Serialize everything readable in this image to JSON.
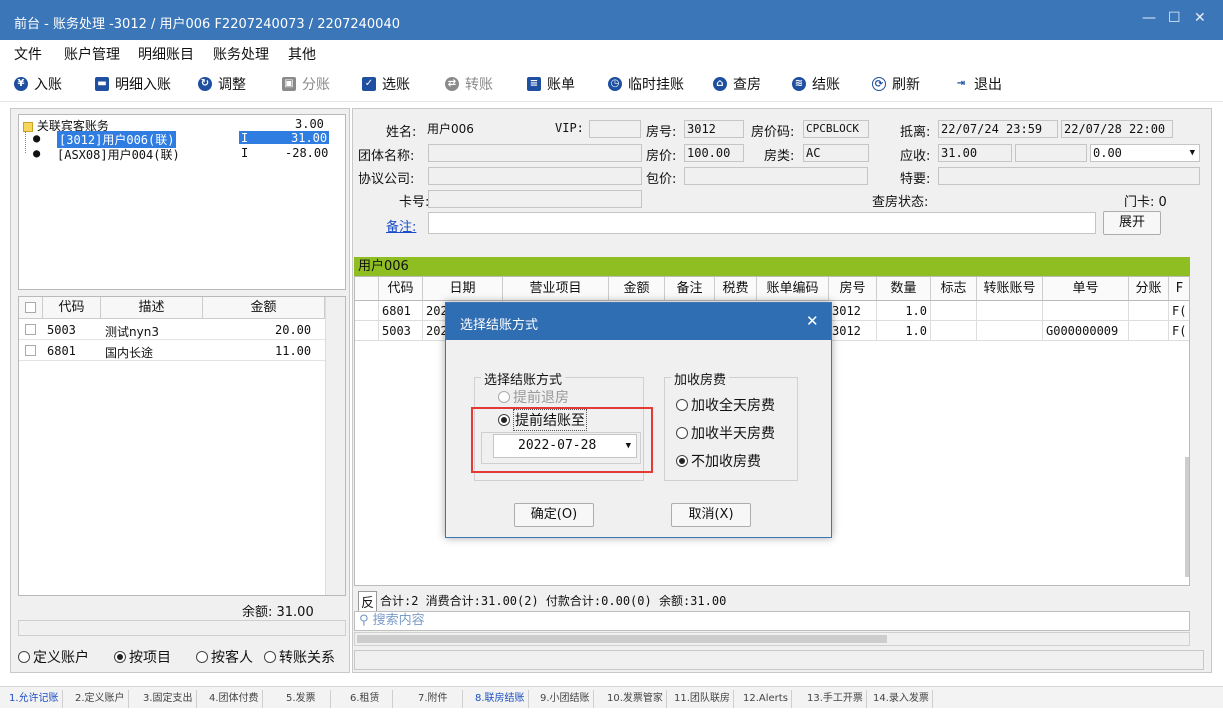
{
  "window": {
    "title": "前台 - 账务处理 -3012 / 用户006 F2207240073 / 2207240040",
    "controls": [
      "—",
      "☐",
      "✕"
    ]
  },
  "menu": [
    "文件",
    "账户管理",
    "明细账目",
    "账务处理",
    "其他"
  ],
  "toolbar": [
    {
      "label": "入账",
      "icon": "coin-icon",
      "color": "#1f4fa0",
      "enabled": true
    },
    {
      "label": "明细入账",
      "icon": "card-icon",
      "color": "#1f4fa0",
      "enabled": true
    },
    {
      "label": "调整",
      "icon": "adjust-icon",
      "color": "#1f4fa0",
      "enabled": true
    },
    {
      "label": "分账",
      "icon": "split-icon",
      "color": "#8a8a8a",
      "enabled": false
    },
    {
      "label": "选账",
      "icon": "select-icon",
      "color": "#1f4fa0",
      "enabled": true
    },
    {
      "label": "转账",
      "icon": "transfer-icon",
      "color": "#8a8a8a",
      "enabled": false
    },
    {
      "label": "账单",
      "icon": "bill-icon",
      "color": "#1f4fa0",
      "enabled": true
    },
    {
      "label": "临时挂账",
      "icon": "clock-icon",
      "color": "#1f4fa0",
      "enabled": true
    },
    {
      "label": "查房",
      "icon": "house-icon",
      "color": "#1f4fa0",
      "enabled": true
    },
    {
      "label": "结账",
      "icon": "stack-icon",
      "color": "#1f4fa0",
      "enabled": true
    },
    {
      "label": "刷新",
      "icon": "refresh-icon",
      "color": "#1f4fa0",
      "enabled": true
    },
    {
      "label": "退出",
      "icon": "exit-icon",
      "color": "#1f4fa0",
      "enabled": true
    }
  ],
  "tree": {
    "root": {
      "label": "关联宾客账务",
      "amount": "3.00"
    },
    "children": [
      {
        "label": "[3012]用户006(联)",
        "flag": "I",
        "amount": "31.00",
        "selected": true
      },
      {
        "label": "[ASX08]用户004(联)",
        "flag": "I",
        "amount": "-28.00",
        "selected": false
      }
    ]
  },
  "left_table": {
    "headers": [
      "代码",
      "描述",
      "金额"
    ],
    "rows": [
      {
        "code": "5003",
        "desc": "测试nyn3",
        "amount": "20.00"
      },
      {
        "code": "6801",
        "desc": "国内长途",
        "amount": "11.00"
      }
    ],
    "balance": "余额: 31.00"
  },
  "view_options": [
    {
      "label": "定义账户",
      "checked": false
    },
    {
      "label": "按项目",
      "checked": true
    },
    {
      "label": "按客人",
      "checked": false
    },
    {
      "label": "转账关系",
      "checked": false
    }
  ],
  "guest": {
    "name_label": "姓名:",
    "name": "用户006",
    "vip_label": "VIP:",
    "vip": "",
    "room_label": "房号:",
    "room": "3012",
    "rate_code_label": "房价码:",
    "rate_code": "CPCBLOCK",
    "arrival_label": "抵离:",
    "arrival": "22/07/24 23:59",
    "departure": "22/07/28 22:00",
    "group_label": "团体名称:",
    "group": "",
    "rate_label": "房价:",
    "rate": "100.00",
    "room_type_label": "房类:",
    "room_type": "AC",
    "receivable_label": "应收:",
    "receivable": "31.00",
    "receivable_extra": "0.00",
    "company_label": "协议公司:",
    "company": "",
    "package_label": "包价:",
    "package": "",
    "special_label": "特要:",
    "special": "",
    "card_label": "卡号:",
    "card": "",
    "checkroom_label": "查房状态:",
    "checkroom": "",
    "doorcard": "门卡: 0",
    "remark_label": "备注:",
    "remark": "",
    "expand_button": "展开"
  },
  "grid": {
    "owner": "用户006",
    "headers": [
      "代码",
      "日期",
      "营业项目",
      "金额",
      "备注",
      "税费",
      "账单编码",
      "房号",
      "数量",
      "标志",
      "转账账号",
      "单号",
      "分账",
      "F"
    ],
    "rows": [
      [
        "6801",
        "202",
        "",
        "",
        "",
        "",
        "",
        "3012",
        "1.0",
        "",
        "",
        "",
        "",
        "F("
      ],
      [
        "5003",
        "202",
        "",
        "",
        "",
        "",
        "",
        "3012",
        "1.0",
        "",
        "",
        "G000000009",
        "",
        "F("
      ]
    ]
  },
  "summary": {
    "flip": "反",
    "text": "合计:2  消费合计:31.00(2)  付款合计:0.00(0)  余额:31.00"
  },
  "search": {
    "placeholder": "搜索内容"
  },
  "tabs": [
    {
      "label": "1.允许记账",
      "active": true
    },
    {
      "label": "2.定义账户",
      "active": false
    },
    {
      "label": "3.固定支出",
      "active": false
    },
    {
      "label": "4.团体付费",
      "active": false
    },
    {
      "label": "5.发票",
      "active": false
    },
    {
      "label": "6.租赁",
      "active": false
    },
    {
      "label": "7.附件",
      "active": false
    },
    {
      "label": "8.联房结账",
      "active": true
    },
    {
      "label": "9.小团结账",
      "active": false
    },
    {
      "label": "10.发票管家",
      "active": false
    },
    {
      "label": "11.团队联房",
      "active": false
    },
    {
      "label": "12.Alerts",
      "active": false
    },
    {
      "label": "13.手工开票",
      "active": false
    },
    {
      "label": "14.录入发票",
      "active": false
    }
  ],
  "dialog": {
    "title": "选择结账方式",
    "method_group": "选择结账方式",
    "option_early_checkout": "提前退房",
    "option_early_settle": "提前结账至",
    "settle_date": "2022-07-28",
    "fee_group": "加收房费",
    "fee_options": [
      {
        "label": "加收全天房费",
        "checked": false
      },
      {
        "label": "加收半天房费",
        "checked": false
      },
      {
        "label": "不加收房费",
        "checked": true
      }
    ],
    "ok": "确定(O)",
    "cancel": "取消(X)",
    "highlight_color": "#e53935"
  }
}
